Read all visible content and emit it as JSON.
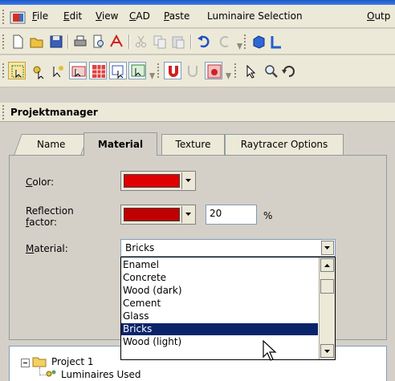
{
  "menubar": {
    "items": [
      "File",
      "Edit",
      "View",
      "CAD",
      "Paste",
      "Luminaire Selection",
      "Outp"
    ]
  },
  "panel": {
    "title": "Projektmanager"
  },
  "tabs": [
    {
      "label": "Name"
    },
    {
      "label": "Material"
    },
    {
      "label": "Texture"
    },
    {
      "label": "Raytracer Options"
    }
  ],
  "material_tab": {
    "color_label_ul": "C",
    "color_label_rest": "olor:",
    "color_value": "#e00000",
    "reflection_label_line1": "Reflection",
    "reflection_label_ul": "f",
    "reflection_label_rest": "actor:",
    "reflection_color_value": "#c00000",
    "reflection_factor": "20",
    "percent_sign": "%",
    "material_label_ul": "M",
    "material_label_rest": "aterial:",
    "material_value": "Bricks",
    "material_options": [
      "Enamel",
      "Concrete",
      "Wood (dark)",
      "Cement",
      "Glass",
      "Bricks",
      "Wood (light)"
    ],
    "selected_index": 5
  },
  "tree": {
    "root": "Project 1",
    "child": "Luminaires Used"
  },
  "icons": {
    "toolbar1": [
      "new-document-icon",
      "open-folder-icon",
      "save-icon",
      "print-icon",
      "print-preview-icon",
      "pdf-icon",
      "cut-icon",
      "copy-icon",
      "paste-icon",
      "undo-icon",
      "redo-icon",
      "3d-cube-icon",
      "floor-plan-icon"
    ],
    "toolbar2": [
      "select-all-icon",
      "luminaire-select-icon",
      "luminaire-arrow-icon",
      "arrange-icon",
      "arrange-grid-icon",
      "select-window-icon",
      "select-zoom-icon",
      "magnet-icon",
      "magnet-off-icon",
      "snap-icon",
      "pointer-icon",
      "zoom-icon",
      "rotate-icon"
    ]
  },
  "colors": {
    "selection": "#0a246a",
    "swatch_red": "#e00000",
    "swatch_darkred": "#c00000"
  }
}
